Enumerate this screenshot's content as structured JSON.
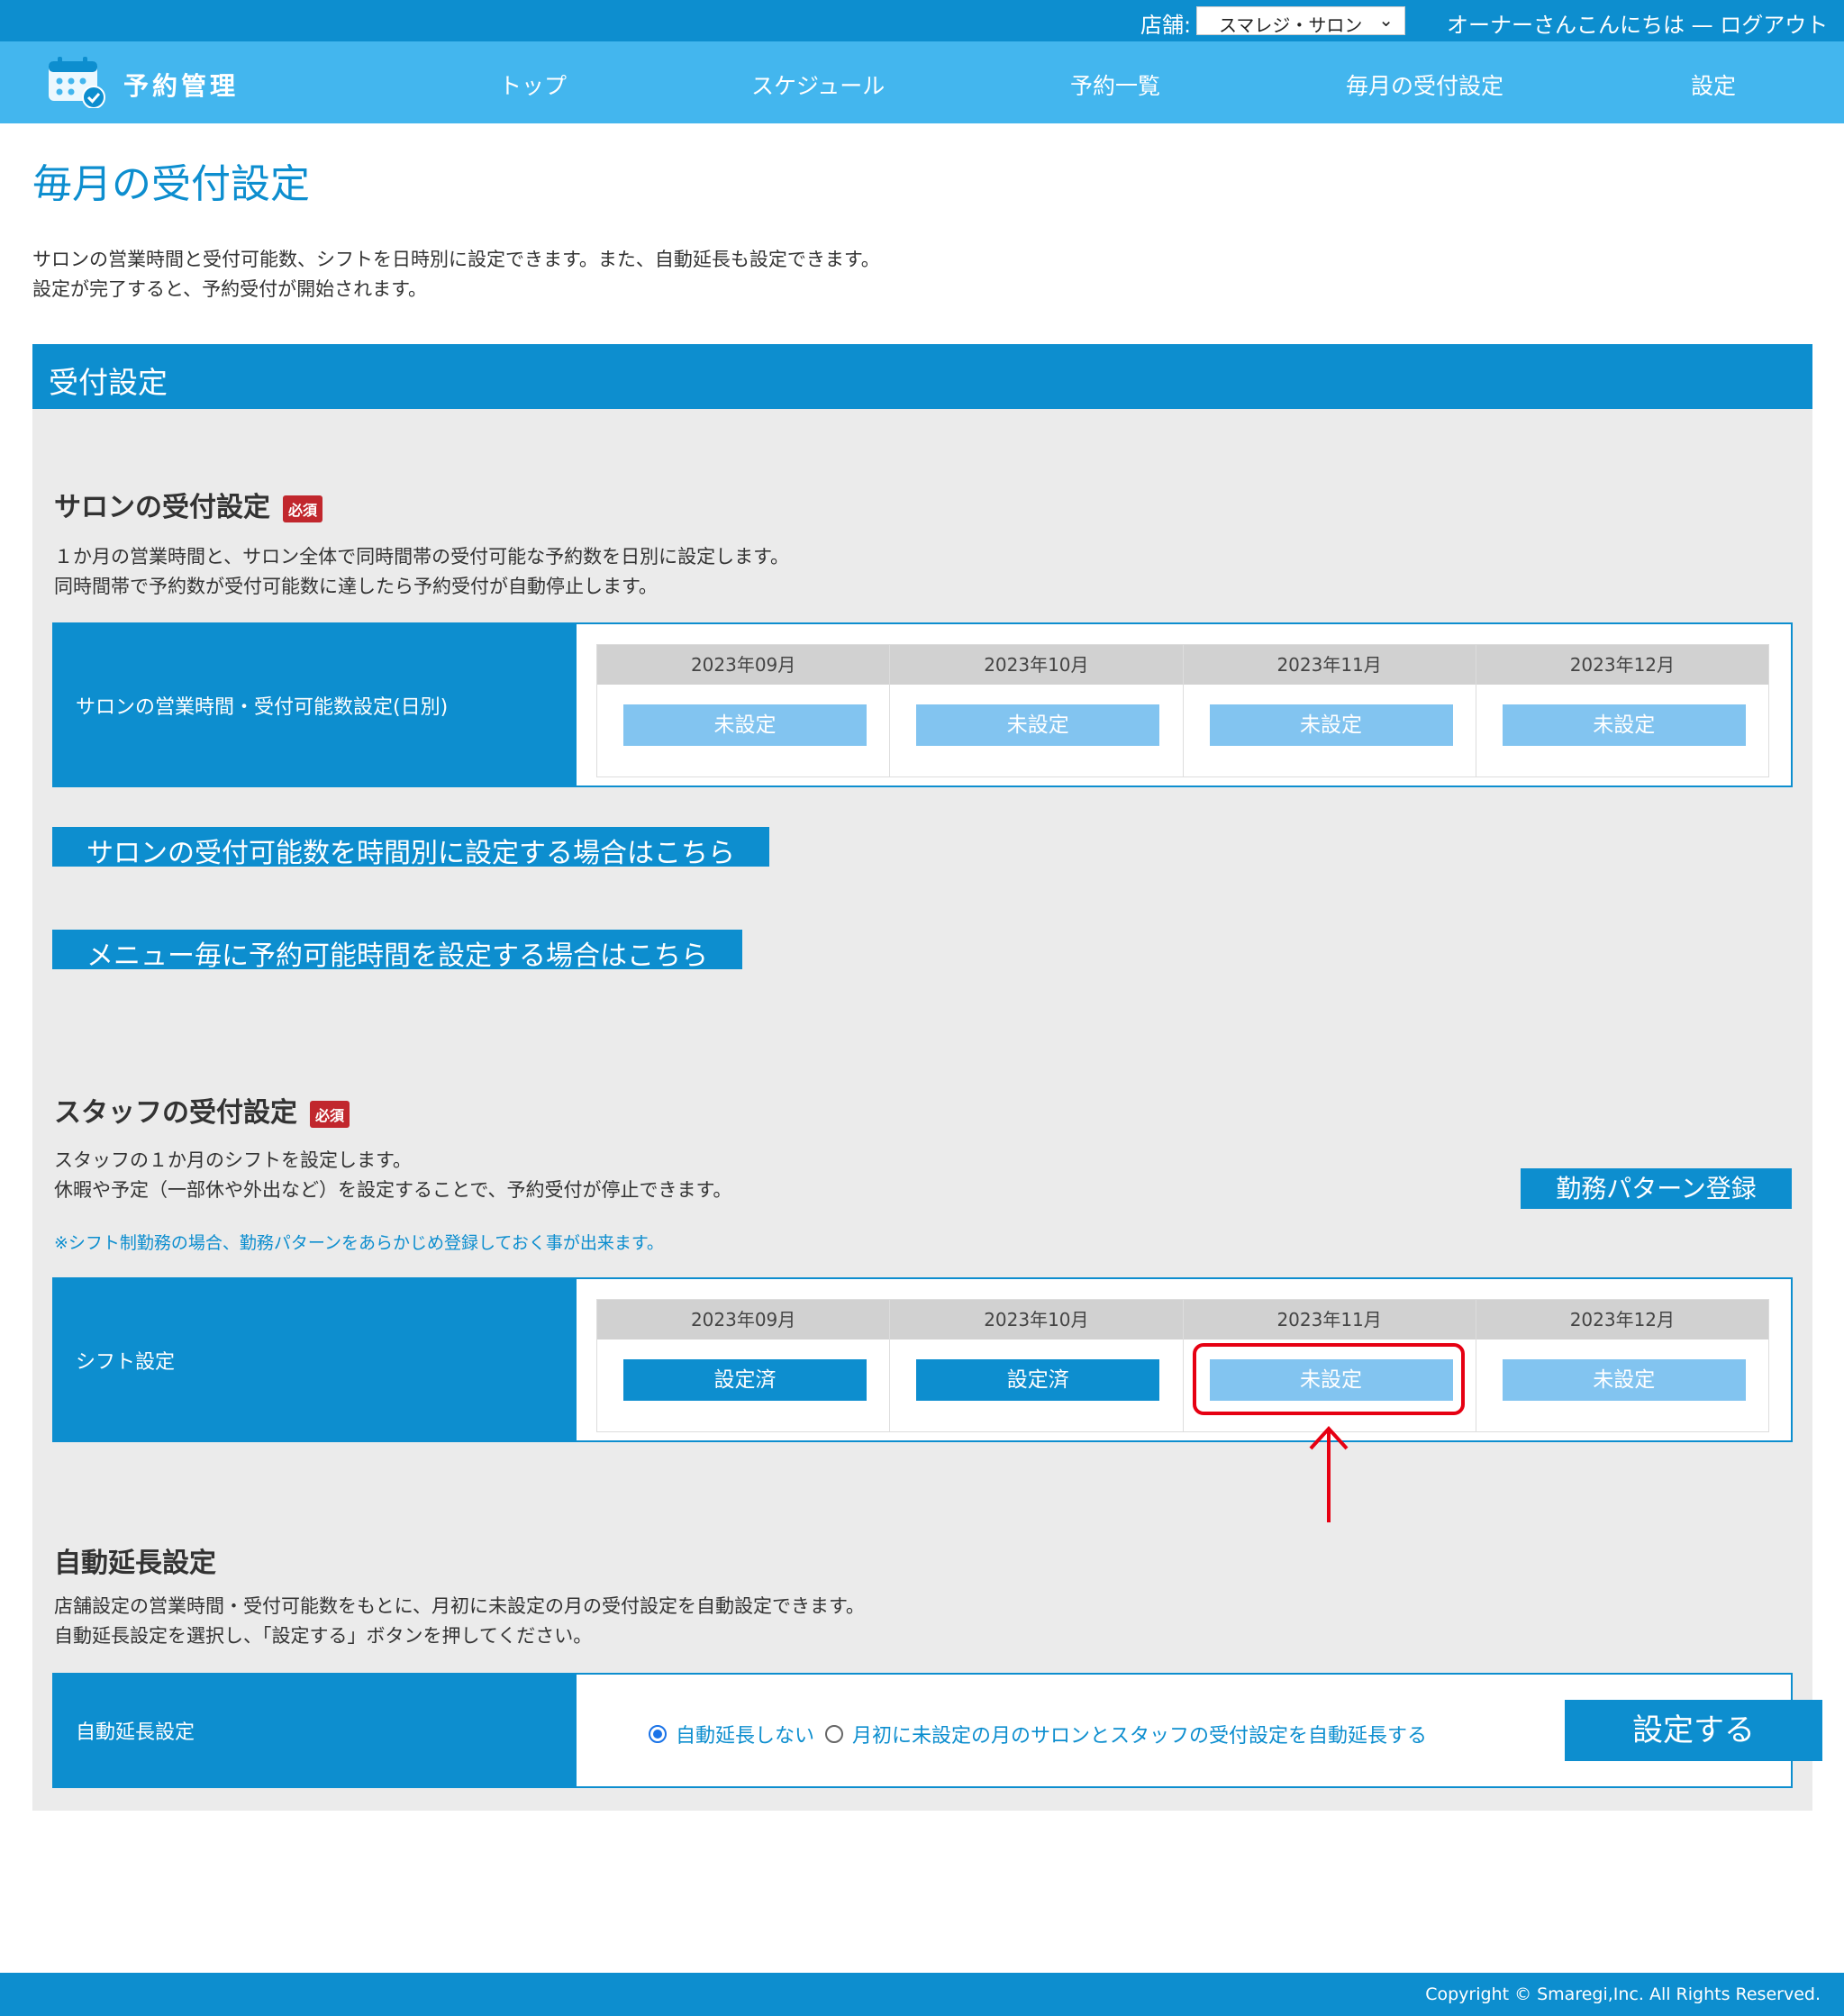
{
  "topbar": {
    "store_label": "店舗:",
    "store_selected": "スマレジ・サロン",
    "greeting": "オーナーさんこんにちは",
    "separator": "—",
    "logout": "ログアウト"
  },
  "nav": {
    "brand": "予約管理",
    "items": [
      "トップ",
      "スケジュール",
      "予約一覧",
      "毎月の受付設定",
      "設定"
    ]
  },
  "page": {
    "title": "毎月の受付設定",
    "intro_line1": "サロンの営業時間と受付可能数、シフトを日時別に設定できます。また、自動延長も設定できます。",
    "intro_line2": "設定が完了すると、予約受付が開始されます。"
  },
  "section": {
    "title": "受付設定"
  },
  "salon": {
    "title": "サロンの受付設定",
    "required": "必須",
    "desc_line1": "１か月の営業時間と、サロン全体で同時間帯の受付可能な予約数を日別に設定します。",
    "desc_line2": "同時間帯で予約数が受付可能数に達したら予約受付が自動停止します。",
    "row_label": "サロンの営業時間・受付可能数設定(日別)",
    "months": [
      {
        "month": "2023年09月",
        "status": "未設定"
      },
      {
        "month": "2023年10月",
        "status": "未設定"
      },
      {
        "month": "2023年11月",
        "status": "未設定"
      },
      {
        "month": "2023年12月",
        "status": "未設定"
      }
    ],
    "link_hourly": "サロンの受付可能数を時間別に設定する場合はこちら",
    "link_menu": "メニュー毎に予約可能時間を設定する場合はこちら"
  },
  "staff": {
    "title": "スタッフの受付設定",
    "required": "必須",
    "desc_line1": "スタッフの１か月のシフトを設定します。",
    "desc_line2": "休暇や予定（一部休や外出など）を設定することで、予約受付が停止できます。",
    "note": "※シフト制勤務の場合、勤務パターンをあらかじめ登録しておく事が出来ます。",
    "pattern_button": "勤務パターン登録",
    "row_label": "シフト設定",
    "months": [
      {
        "month": "2023年09月",
        "status": "設定済"
      },
      {
        "month": "2023年10月",
        "status": "設定済"
      },
      {
        "month": "2023年11月",
        "status": "未設定"
      },
      {
        "month": "2023年12月",
        "status": "未設定"
      }
    ]
  },
  "auto_extend": {
    "title": "自動延長設定",
    "desc_line1": "店舗設定の営業時間・受付可能数をもとに、月初に未設定の月の受付設定を自動設定できます。",
    "desc_line2": "自動延長設定を選択し、「設定する」ボタンを押してください。",
    "row_label": "自動延長設定",
    "option_off": "自動延長しない",
    "option_on": "月初に未設定の月のサロンとスタッフの受付設定を自動延長する",
    "selected": "自動延長しない",
    "apply_button": "設定する"
  },
  "footer": {
    "copyright": "Copyright © Smaregi,Inc. All Rights Reserved."
  },
  "colors": {
    "primary": "#0d8ecf",
    "nav": "#43b6ee",
    "unset_button": "#82c4f0",
    "required_badge": "#c1272d",
    "highlight": "#e60012",
    "panel": "#ebebeb"
  }
}
